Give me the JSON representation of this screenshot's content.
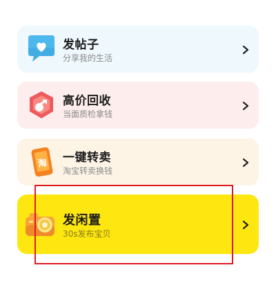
{
  "cards": [
    {
      "title": "发帖子",
      "subtitle": "分享我的生活",
      "icon": "chat-heart-icon",
      "background": "#eef8fd"
    },
    {
      "title": "高价回收",
      "subtitle": "当面质检拿钱",
      "icon": "recycle-coin-icon",
      "background": "#fdeeed"
    },
    {
      "title": "一键转卖",
      "subtitle": "淘宝转卖换钱",
      "icon": "taobao-phone-icon",
      "icon_text": "淘",
      "background": "#fdf4e6"
    },
    {
      "title": "发闲置",
      "subtitle": "30s发布宝贝",
      "icon": "camera-icon",
      "background": "#fee710"
    }
  ],
  "colors": {
    "highlight": "#e0191f",
    "accent_yellow": "#fee710"
  }
}
